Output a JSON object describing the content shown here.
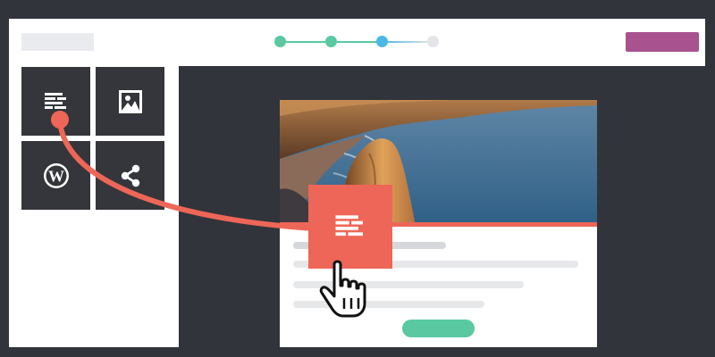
{
  "theme": {
    "background": "#31343a",
    "panel": "#ffffff",
    "tile": "#34363b",
    "accent": "#ee6657",
    "brand": "#a8528f",
    "step_done": "#5ac9a1",
    "step_active": "#4ab9e6",
    "step_pending": "#e3e5e8",
    "cta": "#5ac9a1"
  },
  "header": {
    "stepper": {
      "total_steps": 4,
      "completed_steps": 2,
      "active_step": 3
    }
  },
  "sidebar": {
    "blocks": [
      {
        "name": "text-block",
        "icon": "text-lines-icon"
      },
      {
        "name": "image-block",
        "icon": "image-icon"
      },
      {
        "name": "wordpress-block",
        "icon": "wordpress-icon"
      },
      {
        "name": "share-block",
        "icon": "share-icon"
      }
    ]
  },
  "canvas": {
    "card": {
      "image": "coastal-cliffs-photo",
      "has_cta_button": true
    }
  },
  "drag": {
    "block": "text-block",
    "icon": "text-lines-icon",
    "cursor": "hand-pointer-icon"
  }
}
